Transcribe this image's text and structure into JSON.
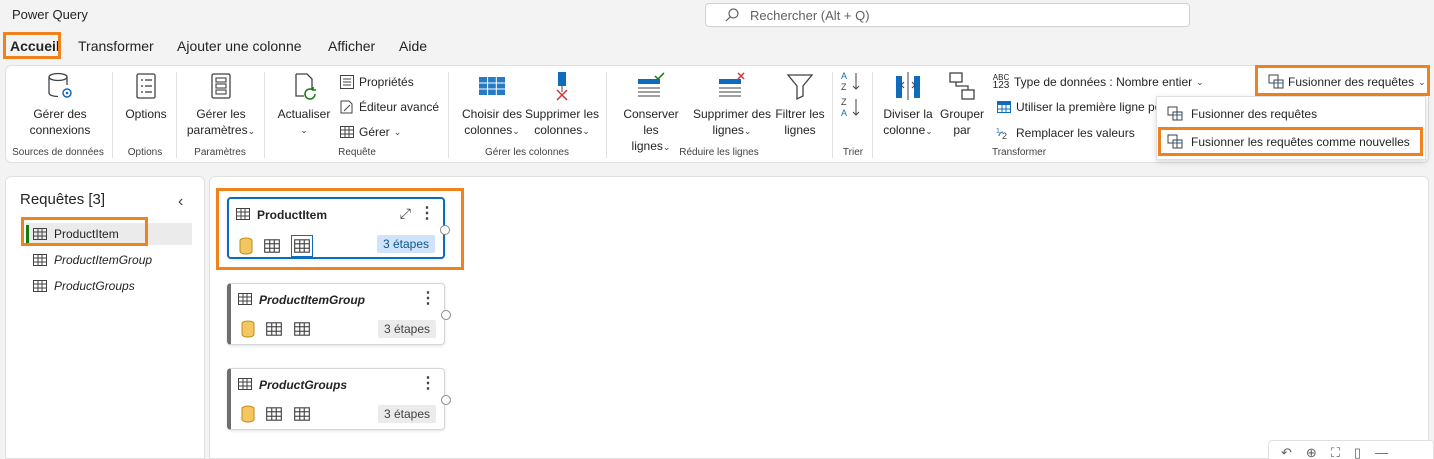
{
  "app": {
    "title": "Power Query"
  },
  "search": {
    "placeholder": "Rechercher (Alt + Q)"
  },
  "menu": {
    "tabs": [
      {
        "label": "Accueil"
      },
      {
        "label": "Transformer"
      },
      {
        "label": "Ajouter une colonne"
      },
      {
        "label": "Afficher"
      },
      {
        "label": "Aide"
      }
    ]
  },
  "ribbon": {
    "sources": {
      "btn": "Gérer des connexions",
      "btn_line1": "Gérer des",
      "btn_line2": "connexions",
      "label": "Sources de données"
    },
    "options": {
      "btn": "Options",
      "label": "Options"
    },
    "params": {
      "btn_line1": "Gérer les",
      "btn_line2": "paramètres",
      "label": "Paramètres"
    },
    "query": {
      "refresh_line1": "Actualiser",
      "properties": "Propriétés",
      "advanced_editor": "Éditeur avancé",
      "manage": "Gérer",
      "label": "Requête"
    },
    "columns": {
      "choose_line1": "Choisir des",
      "choose_line2": "colonnes",
      "remove_line1": "Supprimer les",
      "remove_line2": "colonnes",
      "label": "Gérer les colonnes"
    },
    "rows": {
      "keep_line1": "Conserver les",
      "keep_line2": "lignes",
      "remove_line1": "Supprimer des",
      "remove_line2": "lignes",
      "filter_line1": "Filtrer les",
      "filter_line2": "lignes",
      "label": "Réduire les lignes"
    },
    "sort": {
      "label": "Trier"
    },
    "transform": {
      "split_line1": "Diviser la",
      "split_line2": "colonne",
      "group_line1": "Grouper",
      "group_line2": "par",
      "datatype": "Type de données : Nombre entier",
      "first_row": "Utiliser la première ligne po",
      "replace": "Remplacer les valeurs",
      "label": "Transformer",
      "abc_top": "ABC",
      "abc_bottom": "123"
    },
    "merge": {
      "btn": "Fusionner des requêtes"
    }
  },
  "dropdown": {
    "items": [
      {
        "label": "Fusionner des requêtes"
      },
      {
        "label": "Fusionner les requêtes comme nouvelles"
      }
    ]
  },
  "queries_panel": {
    "title": "Requêtes [3]",
    "items": [
      {
        "label": "ProductItem"
      },
      {
        "label": "ProductItemGroup"
      },
      {
        "label": "ProductGroups"
      }
    ]
  },
  "cards": [
    {
      "title": "ProductItem",
      "steps": "3 étapes"
    },
    {
      "title": "ProductItemGroup",
      "steps": "3 étapes"
    },
    {
      "title": "ProductGroups",
      "steps": "3 étapes"
    }
  ],
  "colors": {
    "highlight": "#f0821e",
    "selected": "#0f6cbd",
    "table_icon": "#424242",
    "db_icon": "#e8a317"
  }
}
